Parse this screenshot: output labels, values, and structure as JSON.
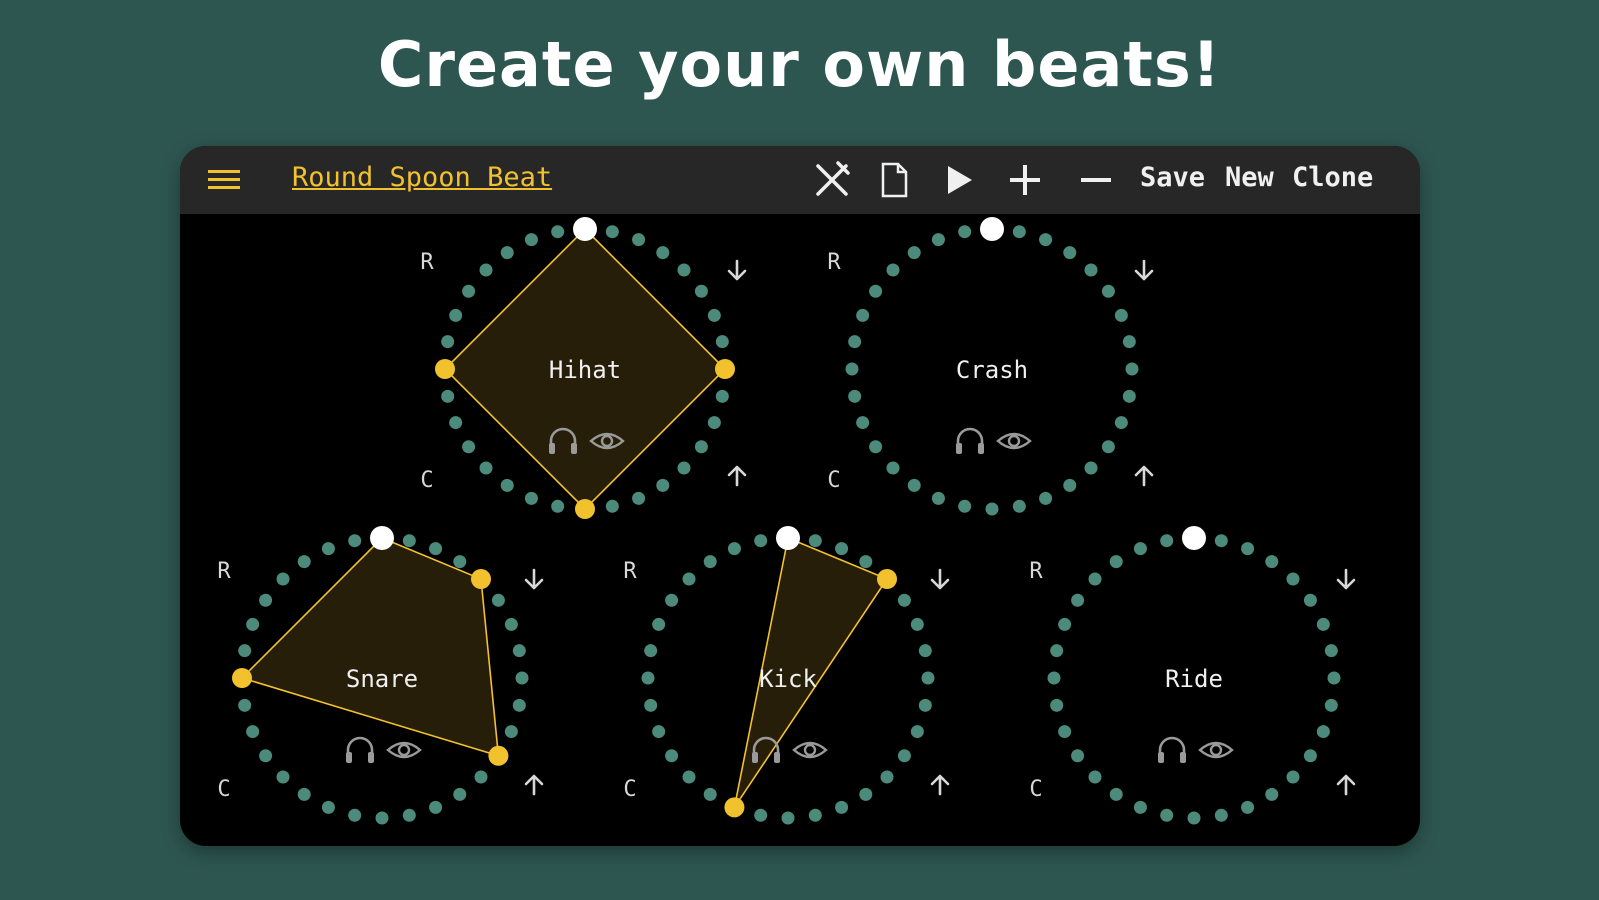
{
  "headline": "Create your own beats!",
  "toolbar": {
    "menu_icon": "hamburger-menu-icon",
    "beat_title": "Round Spoon Beat",
    "icons": [
      "scissors-icon",
      "new-file-icon",
      "play-icon",
      "plus-icon",
      "minus-icon"
    ],
    "save_label": "Save",
    "new_label": "New",
    "clone_label": "Clone"
  },
  "colors": {
    "background": "#2e5650",
    "toolbar": "#272727",
    "accent": "#f2c12e",
    "dot": "#4c8a7c",
    "canvas": "#000000",
    "text": "#f0f0f0"
  },
  "circle_controls": {
    "top_left": "R",
    "bottom_left": "C",
    "top_right_icon": "arrow-down-icon",
    "bottom_right_icon": "arrow-up-icon",
    "listen_icon": "headphones-icon",
    "visibility_icon": "eye-icon"
  },
  "instruments": [
    {
      "name": "Hihat",
      "steps": 32,
      "active_steps": [
        8,
        16,
        24
      ],
      "shape": "polygon"
    },
    {
      "name": "Crash",
      "steps": 32,
      "active_steps": [],
      "shape": "none"
    },
    {
      "name": "Snare",
      "steps": 32,
      "active_steps": [
        4,
        11,
        24
      ],
      "shape": "polygon"
    },
    {
      "name": "Kick",
      "steps": 32,
      "active_steps": [
        4,
        18
      ],
      "shape": "polygon"
    },
    {
      "name": "Ride",
      "steps": 32,
      "active_steps": [],
      "shape": "none"
    }
  ]
}
